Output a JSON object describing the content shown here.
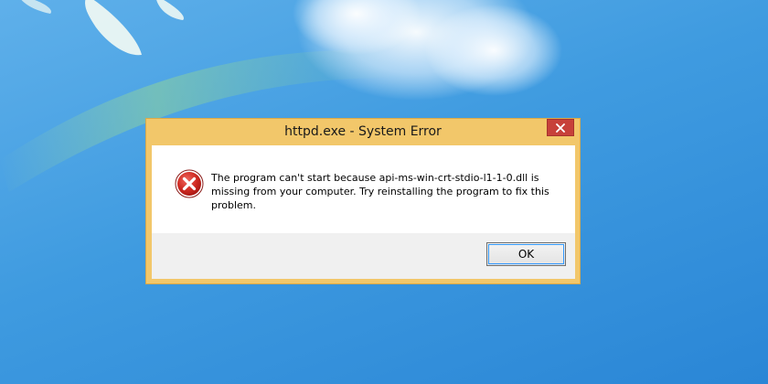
{
  "window": {
    "title": "httpd.exe - System Error"
  },
  "message": {
    "text": "The program can't start because api-ms-win-crt-stdio-l1-1-0.dll is missing from your computer. Try reinstalling the program to fix this problem."
  },
  "buttons": {
    "ok_label": "OK"
  },
  "icons": {
    "close": "close-icon",
    "error": "error-icon"
  },
  "colors": {
    "frame": "#f2c76a",
    "close_button": "#c7413a",
    "error_icon": "#c8201d",
    "desktop": "#3f9be0"
  }
}
